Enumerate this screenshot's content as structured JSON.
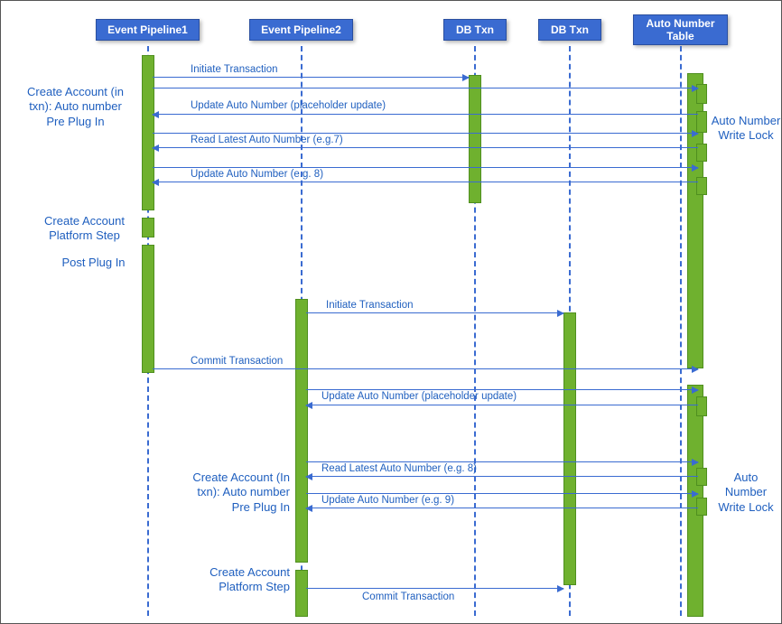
{
  "participants": {
    "p1": "Event Pipeline1",
    "p2": "Event Pipeline2",
    "db1": "DB Txn",
    "db2": "DB Txn",
    "an": "Auto Number Table"
  },
  "messages": {
    "m1": "Initiate Transaction",
    "m2": "Update Auto Number (placeholder update)",
    "m3": "Read Latest Auto Number (e.g.7)",
    "m4": "Update Auto Number (e.g. 8)",
    "m5": "Initiate Transaction",
    "m6": "Commit Transaction",
    "m7": "Update Auto Number (placeholder update)",
    "m8": "Read Latest Auto Number (e.g. 8)",
    "m9": "Update Auto Number (e.g. 9)",
    "m10": "Commit Transaction"
  },
  "notes": {
    "n1": "Create Account (in txn): Auto number Pre Plug In",
    "n2": "Create Account Platform Step",
    "n3": "Post Plug In",
    "n4": "Auto Number Write Lock",
    "n5": "Create Account (In txn): Auto number Pre Plug In",
    "n6": "Create Account Platform Step",
    "n7": "Auto Number Write Lock"
  }
}
